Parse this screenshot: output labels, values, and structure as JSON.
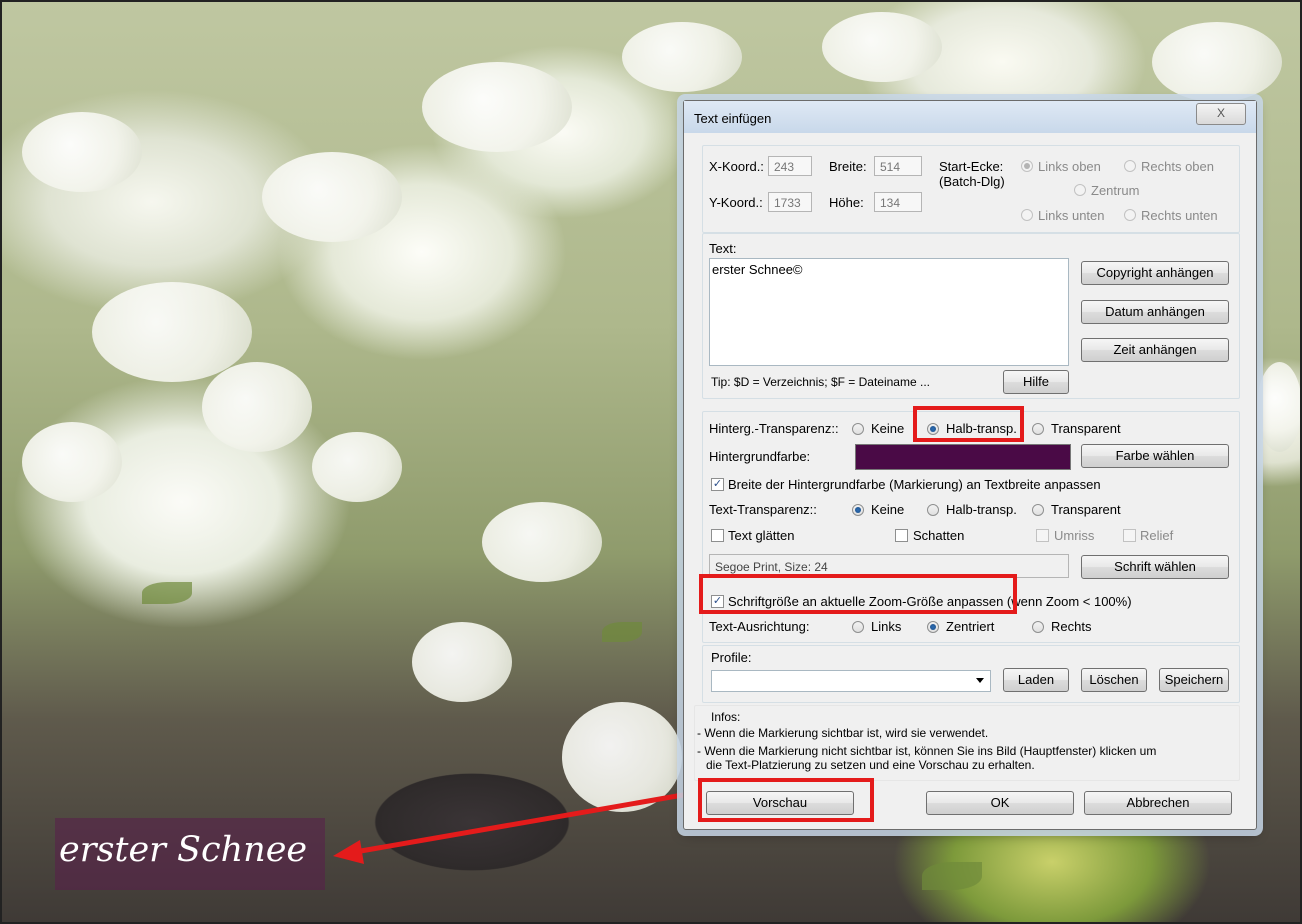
{
  "overlay": {
    "caption": "erster Schnee"
  },
  "dialog": {
    "title": "Text einfügen",
    "close_label": "X",
    "coords": {
      "x_label": "X-Koord.:",
      "x_value": "243",
      "y_label": "Y-Koord.:",
      "y_value": "1733",
      "width_label": "Breite:",
      "width_value": "514",
      "height_label": "Höhe:",
      "height_value": "134",
      "start_label_1": "Start-Ecke:",
      "start_label_2": "(Batch-Dlg)",
      "corners": {
        "top_left": "Links oben",
        "top_right": "Rechts oben",
        "center": "Zentrum",
        "bottom_left": "Links unten",
        "bottom_right": "Rechts unten"
      },
      "selected_corner": "Links oben"
    },
    "text_section": {
      "label": "Text:",
      "value": "erster Schnee©",
      "tip": "Tip: $D = Verzeichnis; $F = Dateiname ...",
      "help_button": "Hilfe",
      "copyright_button": "Copyright anhängen",
      "date_button": "Datum anhängen",
      "time_button": "Zeit anhängen"
    },
    "style_section": {
      "bg_transparency_label": "Hinterg.-Transparenz::",
      "bg_transparency_options": [
        "Keine",
        "Halb-transp.",
        "Transparent"
      ],
      "bg_transparency_selected": "Halb-transp.",
      "bg_color_label": "Hintergrundfarbe:",
      "bg_color": "#4a0a46",
      "choose_color_button": "Farbe wählen",
      "fit_bg_width_label": "Breite der Hintergrundfarbe (Markierung) an Textbreite anpassen",
      "fit_bg_width_checked": true,
      "text_transparency_label": "Text-Transparenz::",
      "text_transparency_options": [
        "Keine",
        "Halb-transp.",
        "Transparent"
      ],
      "text_transparency_selected": "Keine",
      "smooth_label": "Text glätten",
      "shadow_label": "Schatten",
      "outline_label": "Umriss",
      "relief_label": "Relief",
      "font_value": "Segoe Print, Size: 24",
      "choose_font_button": "Schrift wählen",
      "zoom_fit_label": "Schriftgröße an aktuelle Zoom-Größe anpassen (wenn Zoom < 100%)",
      "zoom_fit_checked": true,
      "alignment_label": "Text-Ausrichtung:",
      "alignment_options": [
        "Links",
        "Zentriert",
        "Rechts"
      ],
      "alignment_selected": "Zentriert"
    },
    "profiles": {
      "label": "Profile:",
      "load_button": "Laden",
      "delete_button": "Löschen",
      "save_button": "Speichern"
    },
    "infos": {
      "label": "Infos:",
      "line1": "- Wenn die Markierung sichtbar ist, wird sie verwendet.",
      "line2": "- Wenn die Markierung nicht sichtbar ist, können Sie ins Bild (Hauptfenster) klicken um",
      "line3": "die Text-Platzierung zu setzen und eine Vorschau zu erhalten."
    },
    "footer": {
      "preview_button": "Vorschau",
      "ok_button": "OK",
      "cancel_button": "Abbrechen"
    }
  },
  "annotation_color": "#e41b1b"
}
